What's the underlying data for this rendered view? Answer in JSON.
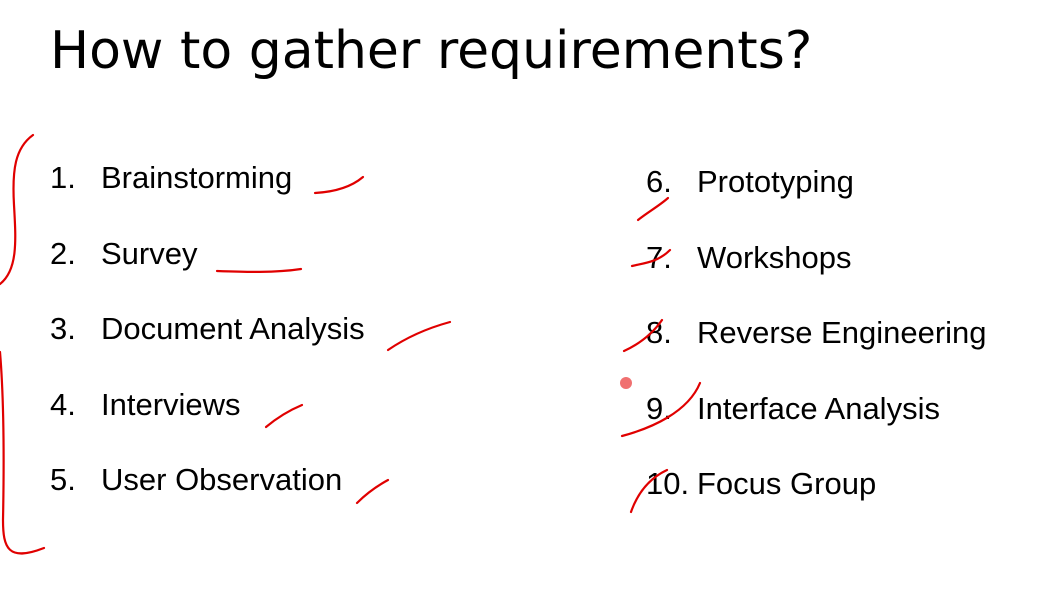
{
  "slide": {
    "title": "How to gather requirements?",
    "left_items": [
      {
        "number": "1.",
        "label": "Brainstorming"
      },
      {
        "number": "2.",
        "label": "Survey"
      },
      {
        "number": "3.",
        "label": "Document Analysis"
      },
      {
        "number": "4.",
        "label": "Interviews"
      },
      {
        "number": "5.",
        "label": "User Observation"
      }
    ],
    "right_items": [
      {
        "number": "6.",
        "label": "Prototyping"
      },
      {
        "number": "7.",
        "label": "Workshops"
      },
      {
        "number": "8.",
        "label": "Reverse Engineering"
      },
      {
        "number": "9.",
        "label": "Interface Analysis"
      },
      {
        "number": "10.",
        "label": "Focus Group"
      }
    ]
  },
  "colors": {
    "background": "#ffffff",
    "text": "#000000",
    "ink": "#e00000",
    "pointer": "#f07070"
  }
}
